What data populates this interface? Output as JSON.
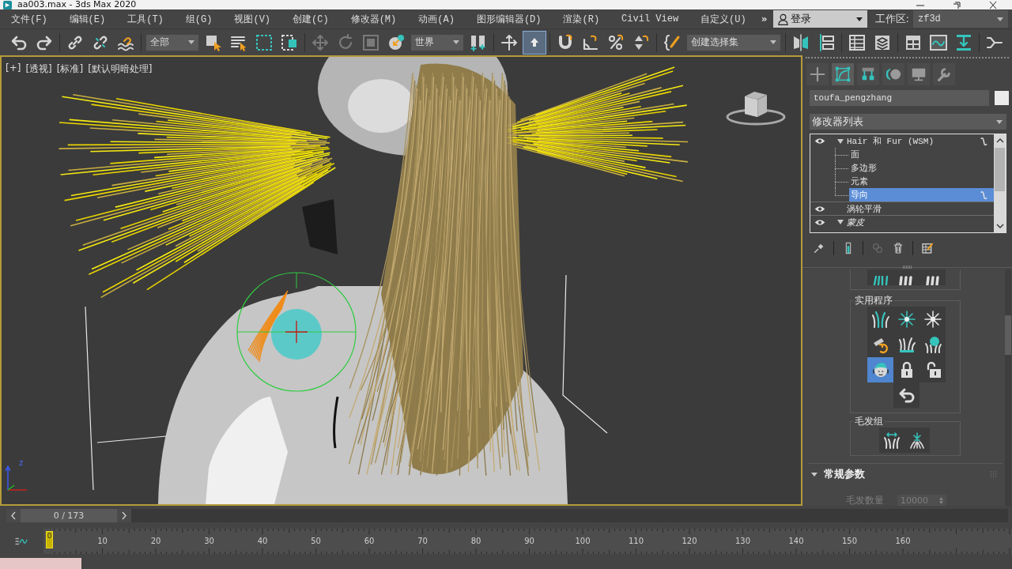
{
  "window": {
    "title": "aa003.max - 3ds Max 2020"
  },
  "menu": {
    "items": [
      "文件(F)",
      "编辑(E)",
      "工具(T)",
      "组(G)",
      "视图(V)",
      "创建(C)",
      "修改器(M)",
      "动画(A)",
      "图形编辑器(D)",
      "渲染(R)",
      "Civil View",
      "自定义(U)"
    ],
    "overflow": "»",
    "sign_in": "登录",
    "workspace_label": "工作区:",
    "workspace": "zf3d"
  },
  "toolbar": {
    "selection_filter": "全部",
    "coordinate_system": "世界",
    "named_selection": "创建选择集",
    "shortcut_override_on": true
  },
  "viewport": {
    "labels": [
      "[+]",
      "[透视]",
      "[标准]",
      "[默认明暗处理]"
    ],
    "axis_label": "z"
  },
  "command_panel": {
    "tabs": [
      {
        "selected": false
      },
      {
        "selected": true
      },
      {
        "selected": false
      },
      {
        "selected": false
      },
      {
        "selected": false
      },
      {
        "selected": false
      }
    ],
    "object": {
      "name": "toufa_pengzhang",
      "color": "#ebebeb"
    },
    "modifier_list": "修改器列表",
    "stack": [
      {
        "label": "Hair 和 Fur (WSM)",
        "eye": true,
        "expanded": true,
        "viewport_off": false,
        "selected": false,
        "badge": true,
        "children": [
          {
            "label": "面",
            "selected": false,
            "badge": false
          },
          {
            "label": "多边形",
            "selected": false,
            "badge": false
          },
          {
            "label": "元素",
            "selected": false,
            "badge": false
          },
          {
            "label": "导向",
            "selected": true,
            "badge": true
          }
        ]
      },
      {
        "label": "涡轮平滑",
        "eye": true,
        "viewport_off": false,
        "selected": false,
        "badge": false
      },
      {
        "label": "蒙皮",
        "eye": true,
        "expanded": true,
        "viewport_off": true,
        "selected": false,
        "badge": false
      }
    ],
    "utility_group": {
      "title": "实用程序",
      "buttons": [
        {
          "selected": false
        },
        {
          "selected": false
        },
        {
          "selected": false
        },
        {
          "selected": false
        },
        {
          "selected": false
        },
        {
          "selected": false
        },
        {
          "selected": true
        },
        {
          "selected": false
        },
        {
          "selected": false
        },
        {
          "selected": false
        }
      ]
    },
    "hair_group": {
      "title": "毛发组",
      "buttons": [
        {
          "selected": false
        },
        {
          "selected": false
        }
      ]
    },
    "rollout": {
      "title": "常规参数",
      "expanded": true,
      "fields": [
        {
          "label": "毛发数量",
          "value": "10000",
          "disabled": true
        }
      ]
    }
  },
  "time_slider": {
    "position": "0 / 173",
    "level": 0
  },
  "track_bar": {
    "current": "0",
    "ticks": [
      "10",
      "20",
      "30",
      "40",
      "50",
      "60",
      "70",
      "80",
      "90",
      "100",
      "110",
      "120",
      "130",
      "140",
      "150",
      "160"
    ]
  }
}
